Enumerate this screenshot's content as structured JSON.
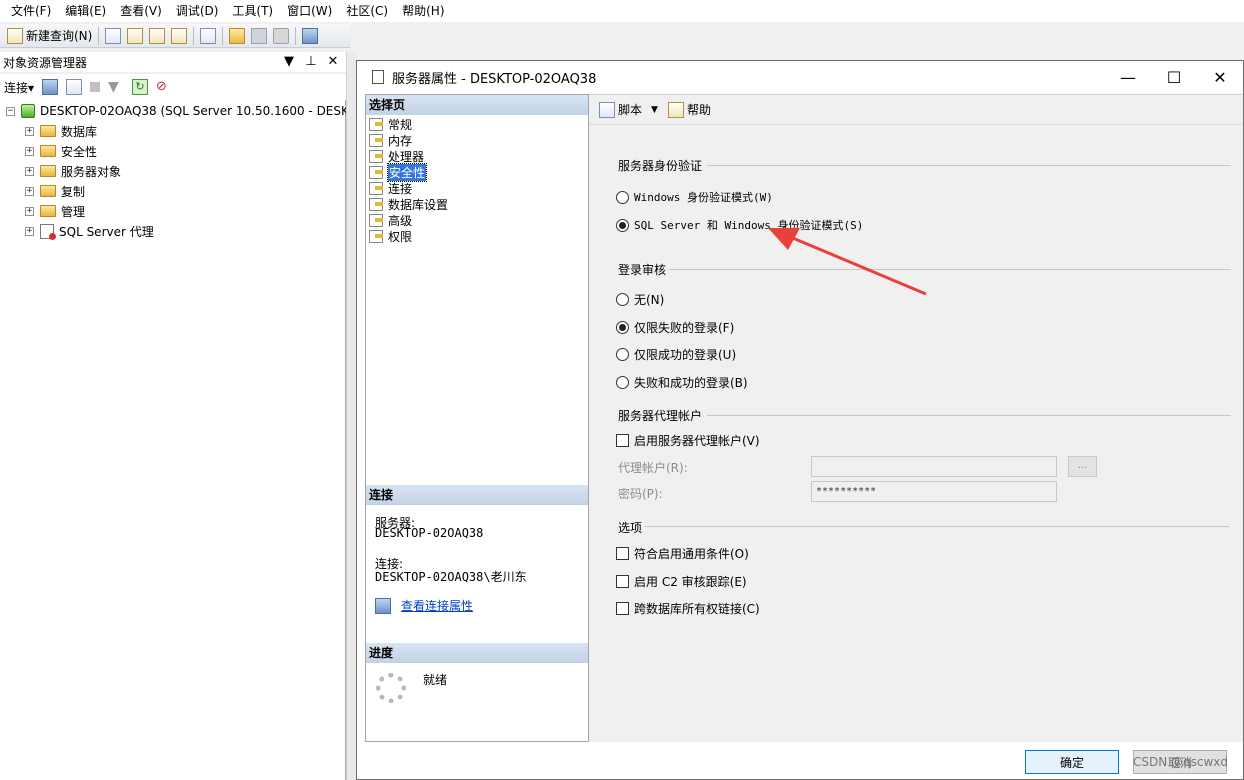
{
  "menubar": {
    "items": [
      "文件(F)",
      "编辑(E)",
      "查看(V)",
      "调试(D)",
      "工具(T)",
      "窗口(W)",
      "社区(C)",
      "帮助(H)"
    ]
  },
  "toolbar": {
    "new_query": "新建查询(N)"
  },
  "object_explorer": {
    "title": "对象资源管理器",
    "connect_label": "连接▾",
    "server_node": "DESKTOP-02OAQ38 (SQL Server 10.50.1600 - DESKT",
    "children": [
      "数据库",
      "安全性",
      "服务器对象",
      "复制",
      "管理",
      "SQL Server 代理"
    ]
  },
  "dialog": {
    "title": "服务器属性 - DESKTOP-02OAQ38",
    "pages_header": "选择页",
    "pages": [
      "常规",
      "内存",
      "处理器",
      "安全性",
      "连接",
      "数据库设置",
      "高级",
      "权限"
    ],
    "selected_page": "安全性",
    "connection_header": "连接",
    "server_label": "服务器:",
    "server_value": "DESKTOP-02OAQ38",
    "connection_label": "连接:",
    "connection_value": "DESKTOP-02OAQ38\\老川东",
    "view_connection_link": "查看连接属性",
    "progress_header": "进度",
    "progress_status": "就绪",
    "script_button": "脚本",
    "help_button": "帮助",
    "auth_section": "服务器身份验证",
    "auth_options": [
      "Windows 身份验证模式(W)",
      "SQL Server 和 Windows 身份验证模式(S)"
    ],
    "auth_selected_index": 1,
    "audit_section": "登录审核",
    "audit_options": [
      "无(N)",
      "仅限失败的登录(F)",
      "仅限成功的登录(U)",
      "失败和成功的登录(B)"
    ],
    "audit_selected_index": 1,
    "proxy_section": "服务器代理帐户",
    "proxy_enable": "启用服务器代理帐户(V)",
    "proxy_account_label": "代理帐户(R):",
    "proxy_account_value": "",
    "password_label": "密码(P):",
    "password_value": "**********",
    "ellipsis": "...",
    "options_section": "选项",
    "options": [
      "符合启用通用条件(O)",
      "启用 C2 审核跟踪(E)",
      "跨数据库所有权链接(C)"
    ],
    "ok_button": "确定",
    "cancel_button": "取消"
  },
  "watermark": "CSDN @qscwxd",
  "colors": {
    "selection": "#3478d8",
    "annotation_arrow": "#e8413b",
    "link": "#0040c0"
  }
}
